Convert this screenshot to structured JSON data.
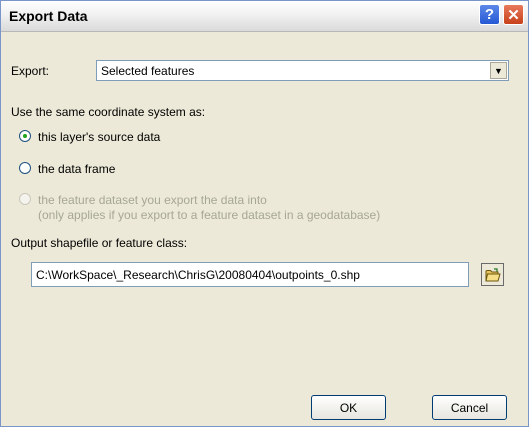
{
  "window": {
    "title": "Export Data",
    "help_glyph": "?",
    "close_glyph": "✕"
  },
  "export": {
    "label": "Export:",
    "selected": "Selected features"
  },
  "coordinate_system": {
    "heading": "Use the same coordinate system as:",
    "options": [
      {
        "label": "this layer's source data",
        "checked": true,
        "enabled": true
      },
      {
        "label": "the data frame",
        "checked": false,
        "enabled": true
      },
      {
        "label": "the feature dataset you export the data into",
        "note": "(only applies if you export to a feature dataset in a geodatabase)",
        "checked": false,
        "enabled": false
      }
    ]
  },
  "output": {
    "label": "Output shapefile or feature class:",
    "path": "C:\\WorkSpace\\_Research\\ChrisG\\20080404\\outpoints_0.shp"
  },
  "buttons": {
    "ok": "OK",
    "cancel": "Cancel"
  },
  "icons": {
    "combo_arrow": "chevron-down-icon",
    "browse": "open-folder-icon"
  }
}
